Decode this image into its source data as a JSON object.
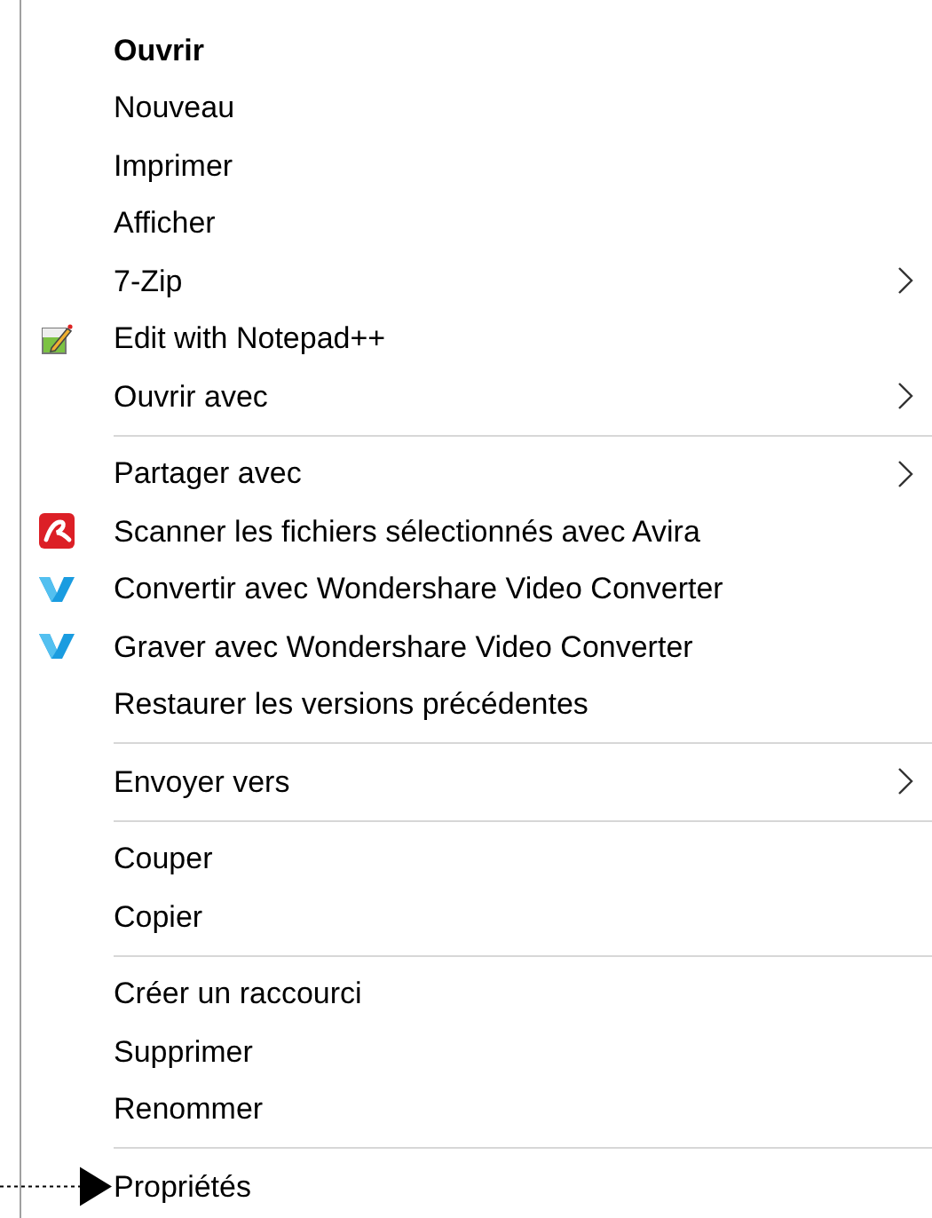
{
  "menu": {
    "items": [
      {
        "kind": "item",
        "label": "Ouvrir",
        "bold": true,
        "submenu": false
      },
      {
        "kind": "item",
        "label": "Nouveau",
        "bold": false,
        "submenu": false
      },
      {
        "kind": "item",
        "label": "Imprimer",
        "bold": false,
        "submenu": false
      },
      {
        "kind": "item",
        "label": "Afficher",
        "bold": false,
        "submenu": false
      },
      {
        "kind": "item",
        "label": "7-Zip",
        "bold": false,
        "submenu": true
      },
      {
        "kind": "notepad",
        "label": "Edit with Notepad++",
        "bold": false,
        "submenu": false
      },
      {
        "kind": "item",
        "label": "Ouvrir avec",
        "bold": false,
        "submenu": true
      },
      {
        "kind": "separator"
      },
      {
        "kind": "item",
        "label": "Partager avec",
        "bold": false,
        "submenu": true
      },
      {
        "kind": "scanner",
        "label": "Scanner les fichiers sélectionnés avec Avira",
        "bold": false,
        "submenu": false
      },
      {
        "kind": "converter",
        "label": "Convertir avec Wondershare Video Converter",
        "bold": false,
        "submenu": false
      },
      {
        "kind": "converter",
        "label": "Graver avec Wondershare Video Converter",
        "bold": false,
        "submenu": false
      },
      {
        "kind": "item",
        "label": "Restaurer les versions précédentes",
        "bold": false,
        "submenu": false
      },
      {
        "kind": "separator"
      },
      {
        "kind": "item",
        "label": "Envoyer vers",
        "bold": false,
        "submenu": true
      },
      {
        "kind": "separator"
      },
      {
        "kind": "item",
        "label": "Couper",
        "bold": false,
        "submenu": false
      },
      {
        "kind": "item",
        "label": "Copier",
        "bold": false,
        "submenu": false
      },
      {
        "kind": "separator"
      },
      {
        "kind": "item",
        "label": "Créer un raccourci",
        "bold": false,
        "submenu": false
      },
      {
        "kind": "item",
        "label": "Supprimer",
        "bold": false,
        "submenu": false
      },
      {
        "kind": "item",
        "label": "Renommer",
        "bold": false,
        "submenu": false
      },
      {
        "kind": "separator"
      },
      {
        "kind": "item",
        "label": "Propriétés",
        "bold": false,
        "submenu": false,
        "pointer": true
      }
    ]
  }
}
